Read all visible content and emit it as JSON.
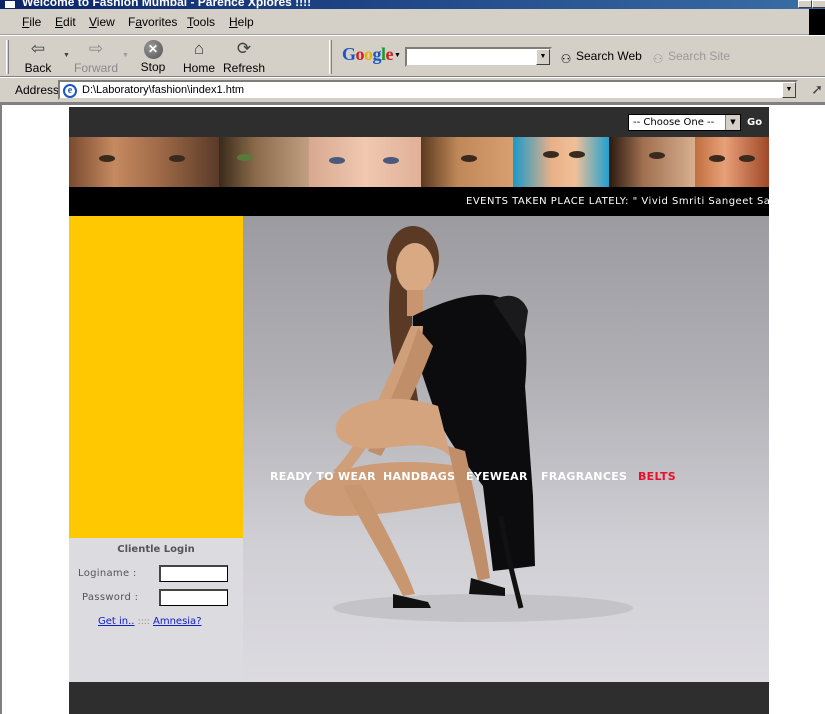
{
  "window": {
    "title": "Welcome to Fashion Mumbai - Parence Xplores !!!!"
  },
  "menubar": {
    "items": [
      "File",
      "Edit",
      "View",
      "Favorites",
      "Tools",
      "Help"
    ]
  },
  "toolbar": {
    "back": "Back",
    "forward": "Forward",
    "stop": "Stop",
    "home": "Home",
    "refresh": "Refresh"
  },
  "google_bar": {
    "logo": "Google",
    "search_value": "",
    "search_web": "Search Web",
    "search_site": "Search Site"
  },
  "address_bar": {
    "label": "Address",
    "url": "D:\\Laboratory\\fashion\\index1.htm"
  },
  "site": {
    "choose_select": "-- Choose One --",
    "go": "Go",
    "marquee": "EVENTS TAKEN PLACE LATELY: \" Vivid Smriti Sangeet Sa",
    "nav": [
      "READY TO WEAR",
      "HANDBAGS",
      "EYEWEAR",
      "FRAGRANCES",
      "BELTS"
    ],
    "login": {
      "title": "Clientle Login",
      "loginname_label": "Loginame :",
      "loginname_value": "",
      "password_label": "Password :",
      "password_value": "",
      "get_in": "Get in..",
      "separator": "::::",
      "amnesia": "Amnesia?"
    }
  },
  "colors": {
    "accent_yellow": "#ffc800",
    "nav_active_red": "#e8102a",
    "site_dark": "#2e2e2e",
    "link_blue": "#1020c8"
  }
}
